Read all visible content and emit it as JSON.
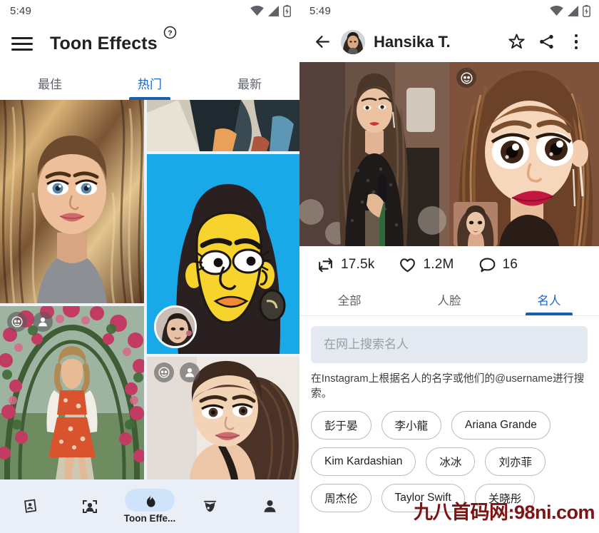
{
  "left_pane": {
    "statusbar": {
      "time": "5:49",
      "icons": [
        "wifi-icon",
        "signal-icon",
        "battery-charging-icon"
      ]
    },
    "appbar": {
      "menu_icon": "hamburger-menu-icon",
      "title": "Toon Effects",
      "help_icon": "help-circle-icon"
    },
    "tabs": [
      {
        "label": "最佳",
        "active": false
      },
      {
        "label": "热门",
        "active": true
      },
      {
        "label": "最新",
        "active": false
      }
    ],
    "grid_items": [
      {
        "name": "toon-portrait-blonde",
        "badges": []
      },
      {
        "name": "toon-partial-top",
        "badges": []
      },
      {
        "name": "toon-simpsons-yellow",
        "badges": [],
        "thumb": "source-face-thumb"
      },
      {
        "name": "toon-garden-rose",
        "badges": [
          "toon-face-icon",
          "person-icon"
        ]
      },
      {
        "name": "toon-portrait-updo",
        "badges": [
          "toon-face-icon",
          "person-icon"
        ]
      }
    ],
    "bottom_nav": [
      {
        "icon": "card-portrait-icon",
        "label": "",
        "active": false
      },
      {
        "icon": "face-scan-icon",
        "label": "",
        "active": false
      },
      {
        "icon": "flame-icon",
        "label": "Toon Effe...",
        "active": true
      },
      {
        "icon": "flower-bud-icon",
        "label": "",
        "active": false
      },
      {
        "icon": "person-icon",
        "label": "",
        "active": false
      }
    ]
  },
  "right_pane": {
    "statusbar": {
      "time": "5:49",
      "icons": [
        "wifi-icon",
        "signal-icon",
        "battery-charging-icon"
      ]
    },
    "appbar": {
      "back_icon": "arrow-left-icon",
      "avatar": "user-avatar",
      "title": "Hansika T.",
      "star_icon": "star-outline-icon",
      "share_icon": "share-icon",
      "more_icon": "more-vertical-icon"
    },
    "hero": {
      "left_image": "original-photo",
      "right_image": "toonified-photo",
      "badge": "toon-face-icon",
      "thumb": "source-face-thumb"
    },
    "stats": [
      {
        "icon": "repost-icon",
        "value": "17.5k"
      },
      {
        "icon": "heart-outline-icon",
        "value": "1.2M"
      },
      {
        "icon": "comment-icon",
        "value": "16"
      }
    ],
    "tabs": [
      {
        "label": "全部",
        "active": false
      },
      {
        "label": "人脸",
        "active": false
      },
      {
        "label": "名人",
        "active": true
      }
    ],
    "search": {
      "placeholder": "在网上搜索名人",
      "value": ""
    },
    "hint": "在Instagram上根据名人的名字或他们的@username进行搜索。",
    "chips": [
      "彭于晏",
      "李小龍",
      "Ariana Grande",
      "Kim Kardashian",
      "冰冰",
      "刘亦菲",
      "周杰伦",
      "Taylor Swift",
      "关晓彤"
    ]
  },
  "watermark": {
    "text": "九八首码网:98ni.com",
    "color": "#7d1414"
  },
  "colors": {
    "accent_blue": "#1967c8",
    "indicator_blue": "#1a5fa8",
    "nav_bg": "#eaeef7",
    "pill_blue": "#cfe4fb",
    "search_bg": "#e4e9f2",
    "text_primary": "#202124",
    "text_secondary": "#5f6368"
  }
}
